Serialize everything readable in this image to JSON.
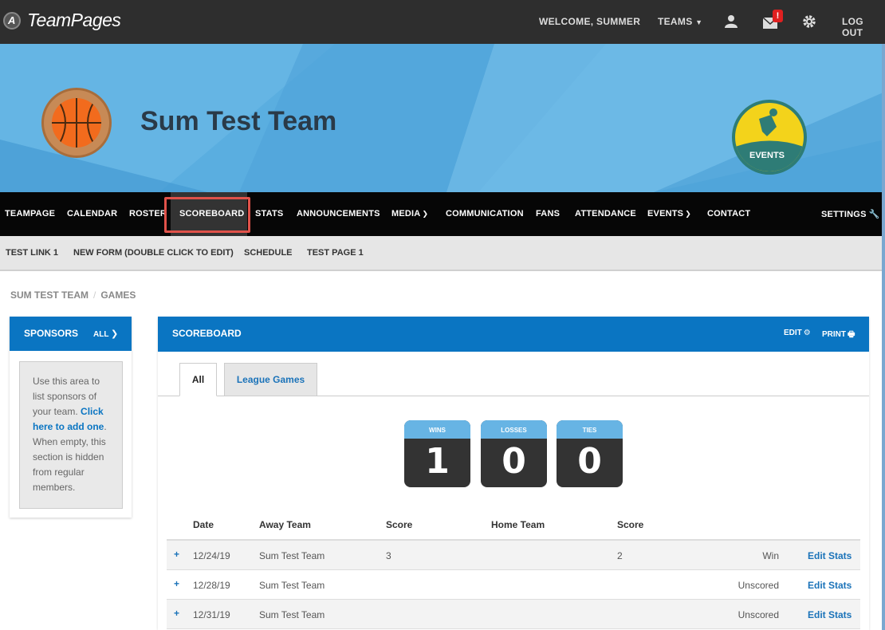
{
  "topbar": {
    "brand": "TeamPages",
    "welcome": "WELCOME, SUMMER",
    "teams": "TEAMS",
    "mail_badge": "!",
    "logout": "LOG OUT"
  },
  "banner": {
    "team_name": "Sum Test Team",
    "sponsor_logo_text": "EVENTS"
  },
  "nav": {
    "items": [
      "TEAMPAGE",
      "CALENDAR",
      "ROSTER",
      "SCOREBOARD",
      "STATS",
      "ANNOUNCEMENTS",
      "MEDIA",
      "COMMUNICATION",
      "FANS",
      "ATTENDANCE",
      "EVENTS",
      "CONTACT"
    ],
    "settings": "SETTINGS"
  },
  "subnav": {
    "items": [
      "TEST LINK 1",
      "NEW FORM (DOUBLE CLICK TO EDIT)",
      "SCHEDULE",
      "TEST PAGE 1"
    ]
  },
  "breadcrumb": {
    "team": "SUM TEST TEAM",
    "sep": "/",
    "page": "GAMES"
  },
  "sponsors": {
    "title": "SPONSORS",
    "all": "ALL",
    "text_before": "Use this area to list sponsors of your team. ",
    "link": "Click here to add one",
    "text_after": ". When empty, this section is hidden from regular members."
  },
  "scoreboard": {
    "title": "SCOREBOARD",
    "edit": "EDIT",
    "print": "PRINT",
    "tabs": [
      "All",
      "League Games"
    ],
    "stats": [
      {
        "label": "WINS",
        "value": "1"
      },
      {
        "label": "LOSSES",
        "value": "0"
      },
      {
        "label": "TIES",
        "value": "0"
      }
    ],
    "columns": [
      "Date",
      "Away Team",
      "Score",
      "Home Team",
      "Score"
    ],
    "games": [
      {
        "plus": "+",
        "date": "12/24/19",
        "away": "Sum Test Team",
        "away_score": "3",
        "home": "",
        "home_score": "2",
        "result": "Win",
        "edit": "Edit Stats"
      },
      {
        "plus": "+",
        "date": "12/28/19",
        "away": "Sum Test Team",
        "away_score": "",
        "home": "",
        "home_score": "",
        "result": "Unscored",
        "edit": "Edit Stats"
      },
      {
        "plus": "+",
        "date": "12/31/19",
        "away": "Sum Test Team",
        "away_score": "",
        "home": "",
        "home_score": "",
        "result": "Unscored",
        "edit": "Edit Stats"
      }
    ]
  },
  "colors": {
    "brand_blue": "#0a75c2",
    "banner_blue": "#5aaee0",
    "highlight": "#e0524a",
    "stat_label": "#67b4e4"
  }
}
